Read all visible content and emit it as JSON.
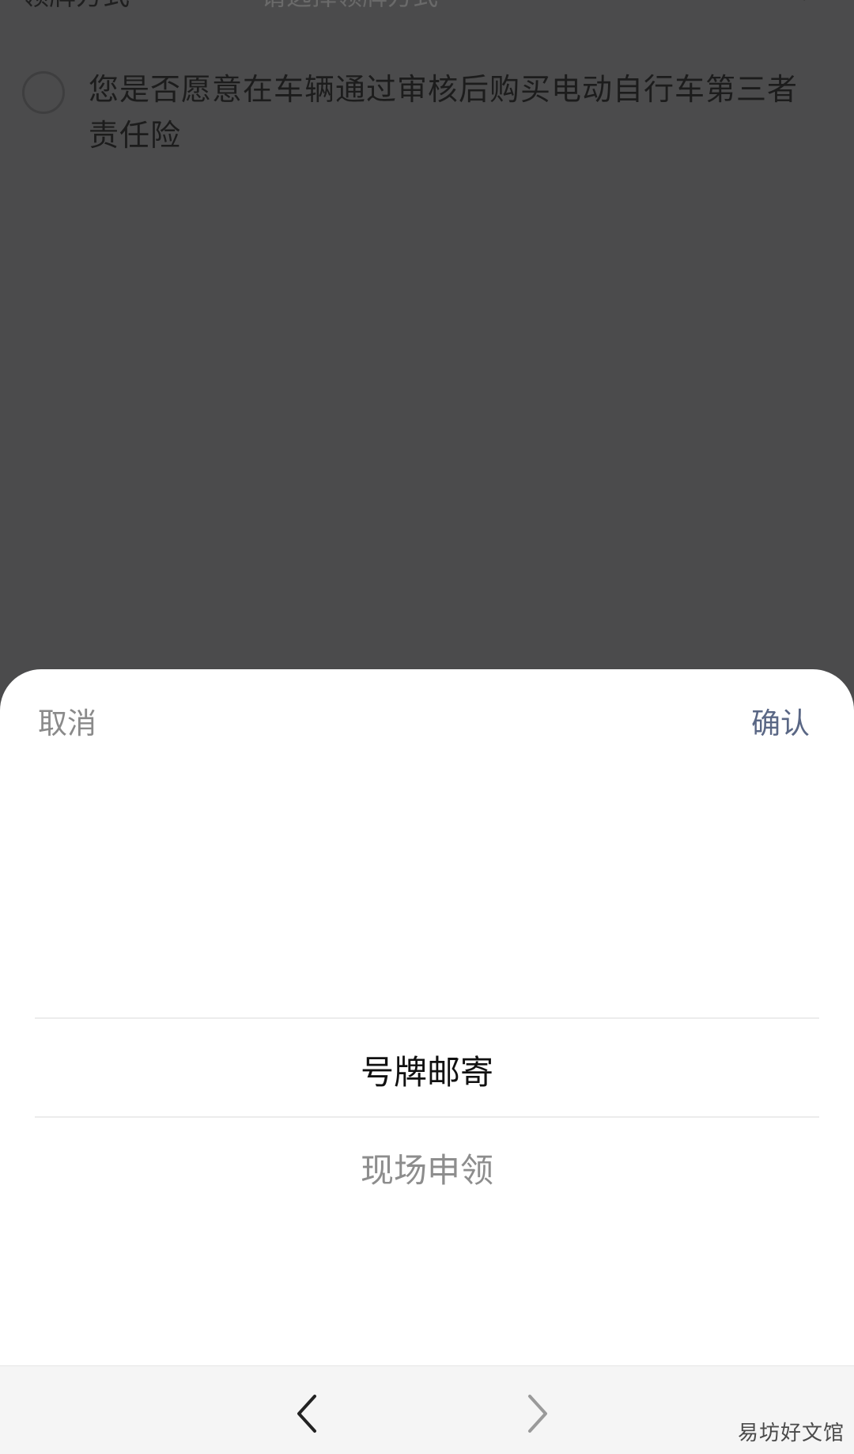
{
  "background_form": {
    "cut_row": {
      "label": "领牌方式",
      "placeholder": "请选择领牌方式"
    },
    "option": {
      "text": "您是否愿意在车辆通过审核后购买电动自行车第三者责任险"
    }
  },
  "sheet": {
    "cancel_label": "取消",
    "confirm_label": "确认",
    "picker_items": [
      {
        "label": "号牌邮寄",
        "selected": true
      },
      {
        "label": "现场申领",
        "selected": false
      }
    ]
  },
  "bottom_bar": {
    "watermark": "易坊好文馆"
  },
  "colors": {
    "overlay": "#4b4b4c",
    "confirm": "#5a6785",
    "cancel": "#8a8a8a"
  }
}
